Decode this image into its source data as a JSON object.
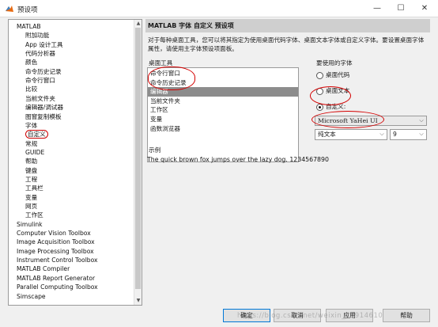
{
  "window": {
    "title": "预设项",
    "minimize": "—",
    "maximize": "☐",
    "close": "✕"
  },
  "tree": {
    "items": [
      {
        "label": "MATLAB",
        "level": 0
      },
      {
        "label": "附加功能",
        "level": 1
      },
      {
        "label": "App 设计工具",
        "level": 1
      },
      {
        "label": "代码分析器",
        "level": 1
      },
      {
        "label": "颜色",
        "level": 1
      },
      {
        "label": "命令历史记录",
        "level": 1
      },
      {
        "label": "命令行窗口",
        "level": 1
      },
      {
        "label": "比较",
        "level": 1
      },
      {
        "label": "当前文件夹",
        "level": 1
      },
      {
        "label": "编辑器/调试器",
        "level": 1
      },
      {
        "label": "图窗复制模板",
        "level": 1
      },
      {
        "label": "字体",
        "level": 1
      },
      {
        "label": "自定义",
        "level": 1,
        "selected": true
      },
      {
        "label": "常规",
        "level": 1
      },
      {
        "label": "GUIDE",
        "level": 1
      },
      {
        "label": "帮助",
        "level": 1
      },
      {
        "label": "键盘",
        "level": 1
      },
      {
        "label": "工程",
        "level": 1
      },
      {
        "label": "工具栏",
        "level": 1
      },
      {
        "label": "变量",
        "level": 1
      },
      {
        "label": "网页",
        "level": 1
      },
      {
        "label": "工作区",
        "level": 1
      },
      {
        "label": "Simulink",
        "level": 0
      },
      {
        "label": "Computer Vision Toolbox",
        "level": 0
      },
      {
        "label": "Image Acquisition Toolbox",
        "level": 0
      },
      {
        "label": "Image Processing Toolbox",
        "level": 0
      },
      {
        "label": "Instrument Control Toolbox",
        "level": 0
      },
      {
        "label": "MATLAB Compiler",
        "level": 0
      },
      {
        "label": "MATLAB Report Generator",
        "level": 0
      },
      {
        "label": "Parallel Computing Toolbox",
        "level": 0
      },
      {
        "label": "Simscape",
        "level": 0
      }
    ]
  },
  "pane": {
    "header": "MATLAB 字体 自定义 预设项",
    "description": "对于每种桌面工具，您可以将其指定为使用桌面代码字体、桌面文本字体或自定义字体。要设置桌面字体属性，请使用主字体预设项面板。",
    "tools_label": "桌面工具",
    "tools": [
      "命令行窗口",
      "命令历史记录",
      "编辑器",
      "当前文件夹",
      "工作区",
      "变量",
      "函数浏览器"
    ],
    "selected_tool_index": 2,
    "font_choice_label": "要使用的字体",
    "font_options": [
      "桌面代码",
      "桌面文本",
      "自定义:"
    ],
    "selected_font_option": 2,
    "custom_font": "Microsoft YaHei UI",
    "font_style": "纯文本",
    "font_size": "9",
    "sample_label": "示例",
    "sample_text": "The quick brown fox jumps over the lazy dog.  1234567890"
  },
  "buttons": {
    "ok": "确定",
    "cancel": "取消",
    "apply": "应用",
    "help": "帮助"
  },
  "watermark": "https://blog.csdn.net/weixin_43914610",
  "colors": {
    "annotation": "#d40000",
    "selection": "#8c8c8c",
    "header": "#cfcfcf"
  }
}
